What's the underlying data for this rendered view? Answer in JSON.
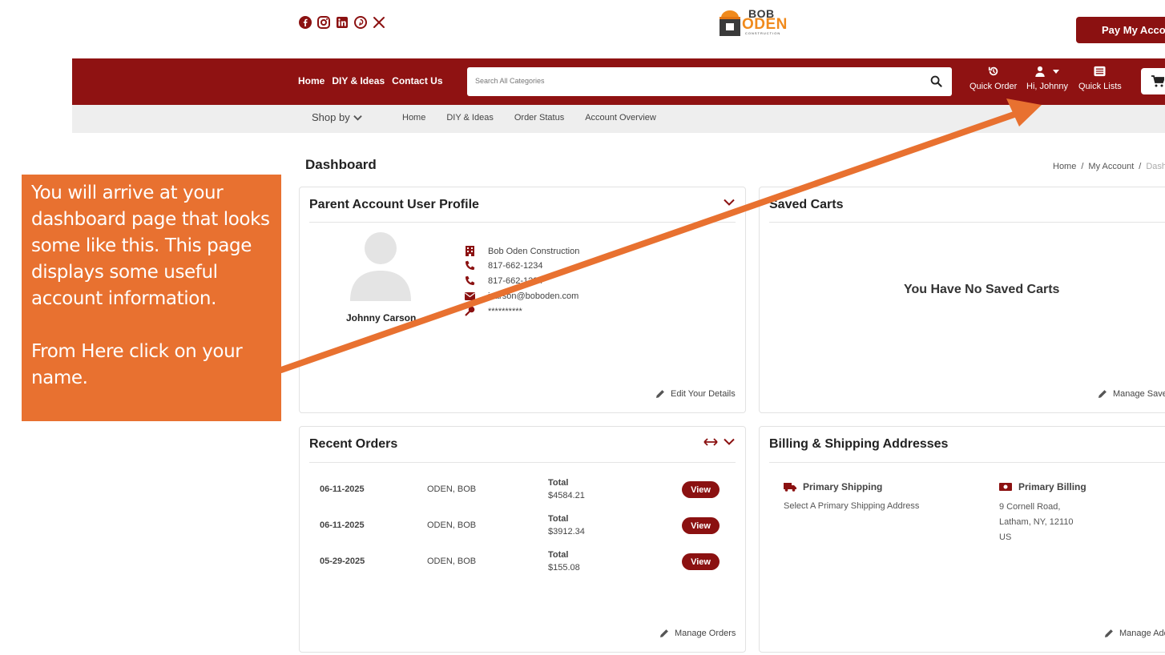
{
  "social": {
    "icons": [
      "facebook-icon",
      "instagram-icon",
      "linkedin-icon",
      "pinterest-icon",
      "x-icon"
    ]
  },
  "logo": {
    "line1": "BOB",
    "line2": "ODEN",
    "line3": "CONSTRUCTION"
  },
  "header": {
    "pay_label": "Pay My Account"
  },
  "nav": {
    "links": [
      "Home",
      "DIY & Ideas",
      "Contact Us"
    ],
    "search_placeholder": "Search All Categories",
    "quick_order": "Quick Order",
    "user": "Hi, Johnny",
    "quick_lists": "Quick Lists"
  },
  "subnav": {
    "shop_by": "Shop by",
    "links": [
      "Home",
      "DIY & Ideas",
      "Order Status",
      "Account Overview"
    ]
  },
  "page": {
    "title": "Dashboard",
    "breadcrumb": [
      "Home",
      "My Account",
      "Dashboard"
    ]
  },
  "profile": {
    "title": "Parent Account User Profile",
    "name": "Johnny Carson",
    "company": "Bob Oden Construction",
    "phone1": "817-662-1234",
    "phone2": "817-662-1234",
    "email": "jcarson@boboden.com",
    "password": "**********",
    "edit_label": "Edit Your Details"
  },
  "saved_carts": {
    "title": "Saved Carts",
    "empty": "You Have No Saved Carts",
    "manage_label": "Manage Saved Carts"
  },
  "orders": {
    "title": "Recent Orders",
    "total_label": "Total",
    "view_label": "View",
    "rows": [
      {
        "date": "06-11-2025",
        "name": "ODEN, BOB",
        "total": "$4584.21"
      },
      {
        "date": "06-11-2025",
        "name": "ODEN, BOB",
        "total": "$3912.34"
      },
      {
        "date": "05-29-2025",
        "name": "ODEN, BOB",
        "total": "$155.08"
      }
    ],
    "manage_label": "Manage Orders"
  },
  "addresses": {
    "title": "Billing & Shipping Addresses",
    "shipping_title": "Primary Shipping",
    "shipping_text": "Select A Primary Shipping Address",
    "billing_title": "Primary Billing",
    "billing_lines": [
      "9 Cornell Road,",
      "Latham, NY, 12110",
      "US"
    ],
    "manage_label": "Manage Addresses"
  },
  "callout": {
    "para1": "You will arrive at your dashboard page that looks some like this. This page displays some useful account information.",
    "para2": "From Here click on your name."
  },
  "colors": {
    "brand_red": "#8f1212",
    "callout_orange": "#e87130",
    "logo_orange": "#f08a1c"
  }
}
